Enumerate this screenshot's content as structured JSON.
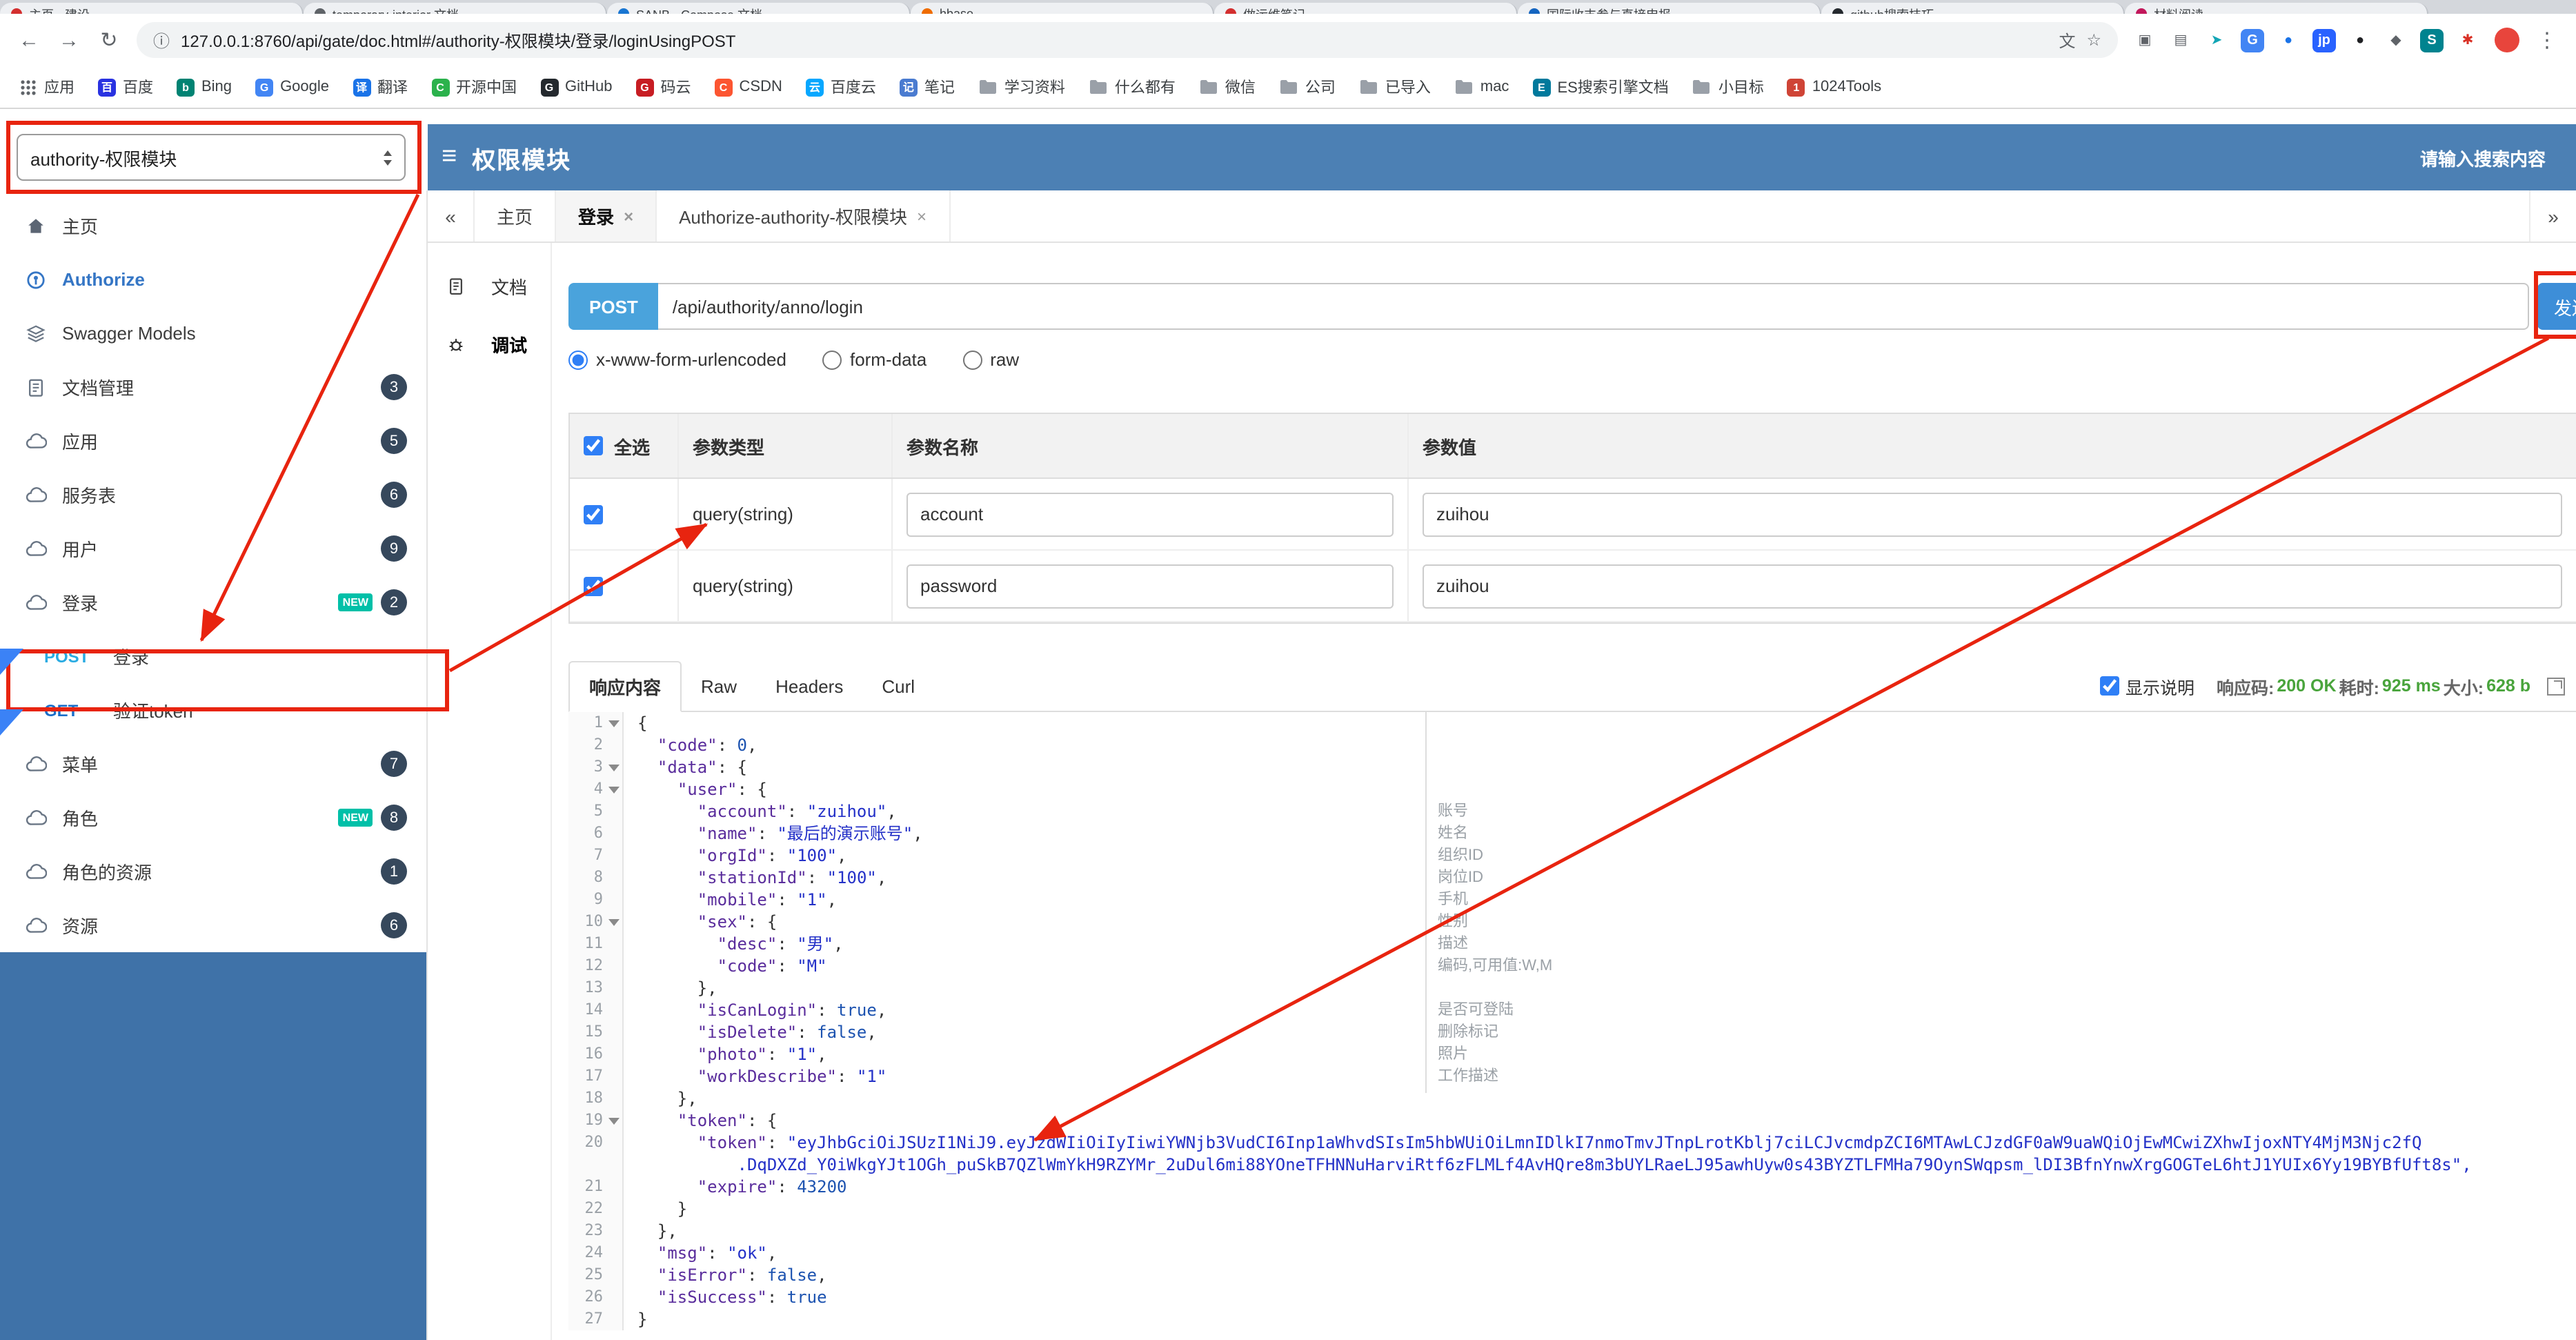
{
  "colors": {
    "header_blue": "#4c80b4",
    "sidebar_fill": "#3f72a8",
    "post_badge": "#4aa3dc",
    "method_post": "#29abe2",
    "method_get": "#1a6fc9",
    "send_button": "#3d8ed8",
    "badge_bg": "#36485c",
    "new_tag": "#00c0a8",
    "success_green": "#49a43c",
    "annotation_red": "#e8240f",
    "marker_blue": "#3b82f6",
    "accent_blue": "#2f7ff6",
    "authorize_blue": "#3576c5"
  },
  "icons": {
    "back": "←",
    "forward": "→",
    "reload": "↻",
    "info": "ⓘ",
    "translate": "文",
    "star": "☆",
    "more": "⋮",
    "hamburger": "≡",
    "prev_tabs": "«",
    "next_tabs": "»",
    "close": "×"
  },
  "browser": {
    "url": "127.0.0.1:8760/api/gate/doc.html#/authority-权限模块/登录/loginUsingPOST",
    "tabs": [
      {
        "title": "主页 - 建设…",
        "color": "#d32f2f"
      },
      {
        "title": "temporary-interior 文档",
        "color": "#5f6368"
      },
      {
        "title": "SANB - Compose 文档",
        "color": "#1976d2"
      },
      {
        "title": "hbase",
        "color": "#ef6c00"
      },
      {
        "title": "做运维笔记",
        "color": "#d32f2f"
      },
      {
        "title": "国际收支参与直接申报",
        "color": "#1565c0"
      },
      {
        "title": "github搜索技巧",
        "color": "#24292e"
      },
      {
        "title": "材料阅读",
        "color": "#c2185b"
      }
    ],
    "extensions": [
      {
        "name": "side-panel-icon",
        "glyph": "▣",
        "fg": "#5f6368",
        "bg": ""
      },
      {
        "name": "reader-ext-icon",
        "glyph": "▤",
        "fg": "#5f6368",
        "bg": ""
      },
      {
        "name": "send-ext-icon",
        "glyph": "➤",
        "fg": "#12a5b5",
        "bg": ""
      },
      {
        "name": "google-ext-icon",
        "glyph": "G",
        "fg": "#ffffff",
        "bg": "#4285f4"
      },
      {
        "name": "docs-ext-icon",
        "glyph": "●",
        "fg": "#1a73e8",
        "bg": ""
      },
      {
        "name": "jp-ext-icon",
        "glyph": "jp",
        "fg": "#ffffff",
        "bg": "#2962ff"
      },
      {
        "name": "circle-ext-icon",
        "glyph": "●",
        "fg": "#202124",
        "bg": ""
      },
      {
        "name": "shield-ext-icon",
        "glyph": "◆",
        "fg": "#5f6368",
        "bg": ""
      },
      {
        "name": "snip-ext-icon",
        "glyph": "S",
        "fg": "#ffffff",
        "bg": "#00838f"
      },
      {
        "name": "pinwheel-ext-icon",
        "glyph": "✱",
        "fg": "#d93025",
        "bg": ""
      }
    ],
    "bookmarks": [
      {
        "label": "应用",
        "icon": "grid"
      },
      {
        "label": "百度",
        "icon": "letter",
        "letter": "百",
        "color": "#2932e1"
      },
      {
        "label": "Bing",
        "icon": "letter",
        "letter": "b",
        "color": "#008373"
      },
      {
        "label": "Google",
        "icon": "letter",
        "letter": "G",
        "color": "#4285f4"
      },
      {
        "label": "翻译",
        "icon": "letter",
        "letter": "译",
        "color": "#1a73e8"
      },
      {
        "label": "开源中国",
        "icon": "letter",
        "letter": "C",
        "color": "#2bb24c"
      },
      {
        "label": "GitHub",
        "icon": "letter",
        "letter": "G",
        "color": "#24292e"
      },
      {
        "label": "码云",
        "icon": "letter",
        "letter": "G",
        "color": "#c71d23"
      },
      {
        "label": "CSDN",
        "icon": "letter",
        "letter": "C",
        "color": "#fc5531"
      },
      {
        "label": "百度云",
        "icon": "letter",
        "letter": "云",
        "color": "#06a7ff"
      },
      {
        "label": "笔记",
        "icon": "letter",
        "letter": "记",
        "color": "#4a7bd0"
      },
      {
        "label": "学习资料",
        "icon": "folder"
      },
      {
        "label": "什么都有",
        "icon": "folder"
      },
      {
        "label": "微信",
        "icon": "folder"
      },
      {
        "label": "公司",
        "icon": "folder"
      },
      {
        "label": "已导入",
        "icon": "folder"
      },
      {
        "label": "mac",
        "icon": "folder"
      },
      {
        "label": "ES搜索引擎文档",
        "icon": "letter",
        "letter": "E",
        "color": "#00799c"
      },
      {
        "label": "小目标",
        "icon": "folder"
      },
      {
        "label": "1024Tools",
        "icon": "letter",
        "letter": "1",
        "color": "#cf4436"
      }
    ]
  },
  "header": {
    "group_select": "authority-权限模块",
    "title": "权限模块",
    "search_placeholder": "请输入搜索内容"
  },
  "sidebar": {
    "new_label": "NEW",
    "items": [
      {
        "label": "主页",
        "icon": "home"
      },
      {
        "label": "Authorize",
        "icon": "auth",
        "accent": true
      },
      {
        "label": "Swagger Models",
        "icon": "models"
      },
      {
        "label": "文档管理",
        "icon": "docs",
        "badge": "3"
      },
      {
        "label": "应用",
        "icon": "api",
        "badge": "5"
      },
      {
        "label": "服务表",
        "icon": "api",
        "badge": "6"
      },
      {
        "label": "用户",
        "icon": "api",
        "badge": "9"
      },
      {
        "label": "登录",
        "icon": "api",
        "badge": "2",
        "isNew": true
      },
      {
        "label": "登录",
        "method": "POST"
      },
      {
        "label": "验证token",
        "method": "GET"
      },
      {
        "label": "菜单",
        "icon": "api",
        "badge": "7"
      },
      {
        "label": "角色",
        "icon": "api",
        "badge": "8",
        "isNew": true
      },
      {
        "label": "角色的资源",
        "icon": "api",
        "badge": "1"
      },
      {
        "label": "资源",
        "icon": "api",
        "badge": "6"
      }
    ]
  },
  "tabs": {
    "items": [
      {
        "label": "主页",
        "closable": false,
        "active": false
      },
      {
        "label": "登录",
        "closable": true,
        "active": true
      },
      {
        "label": "Authorize-authority-权限模块",
        "closable": true,
        "active": false
      }
    ]
  },
  "doc_nav": [
    {
      "label": "文档",
      "icon": "doc",
      "active": false
    },
    {
      "label": "调试",
      "icon": "debug",
      "active": true
    }
  ],
  "debug": {
    "method": "POST",
    "url": "/api/authority/anno/login",
    "send_label": "发送",
    "content_types": [
      {
        "label": "x-www-form-urlencoded",
        "selected": true
      },
      {
        "label": "form-data",
        "selected": false
      },
      {
        "label": "raw",
        "selected": false
      }
    ],
    "params": {
      "select_all_checked": true,
      "headers": {
        "select_all": "全选",
        "type": "参数类型",
        "name": "参数名称",
        "value": "参数值"
      },
      "rows": [
        {
          "checked": true,
          "type": "query(string)",
          "name": "account",
          "value": "zuihou"
        },
        {
          "checked": true,
          "type": "query(string)",
          "name": "password",
          "value": "zuihou"
        }
      ]
    }
  },
  "response": {
    "tabs": [
      {
        "label": "响应内容",
        "active": true
      },
      {
        "label": "Raw",
        "active": false
      },
      {
        "label": "Headers",
        "active": false
      },
      {
        "label": "Curl",
        "active": false
      }
    ],
    "show_desc_label": "显示说明",
    "show_desc_checked": true,
    "meta": {
      "code_label": "响应码:",
      "code": "200 OK",
      "time_label": "耗时:",
      "time": "925 ms",
      "size_label": "大小:",
      "size": "628 b"
    },
    "code_rows": [
      {
        "n": "1",
        "t": "{",
        "fold": true
      },
      {
        "n": "2",
        "t": "  \"code\": 0,"
      },
      {
        "n": "3",
        "t": "  \"data\": {",
        "fold": true
      },
      {
        "n": "4",
        "t": "    \"user\": {",
        "fold": true
      },
      {
        "n": "5",
        "t": "      \"account\": \"zuihou\","
      },
      {
        "n": "6",
        "t": "      \"name\": \"最后的演示账号\","
      },
      {
        "n": "7",
        "t": "      \"orgId\": \"100\","
      },
      {
        "n": "8",
        "t": "      \"stationId\": \"100\","
      },
      {
        "n": "9",
        "t": "      \"mobile\": \"1\","
      },
      {
        "n": "10",
        "t": "      \"sex\": {",
        "fold": true
      },
      {
        "n": "11",
        "t": "        \"desc\": \"男\","
      },
      {
        "n": "12",
        "t": "        \"code\": \"M\""
      },
      {
        "n": "13",
        "t": "      },"
      },
      {
        "n": "14",
        "t": "      \"isCanLogin\": true,"
      },
      {
        "n": "15",
        "t": "      \"isDelete\": false,"
      },
      {
        "n": "16",
        "t": "      \"photo\": \"1\","
      },
      {
        "n": "17",
        "t": "      \"workDescribe\": \"1\""
      },
      {
        "n": "18",
        "t": "    },"
      },
      {
        "n": "19",
        "t": "    \"token\": {",
        "fold": true
      },
      {
        "n": "20",
        "t": "      \"token\": \"eyJhbGciOiJSUzI1NiJ9.eyJzdWIiOiIyIiwiYWNjb3VudCI6Inp1aWhvdSIsIm5hbWUiOiLmnIDlkI7nmoTmvJTnpLrotKblj7ciLCJvcmdpZCI6MTAwLCJzdGF0aW9uaWQiOjEwMCwiZXhwIjoxNTY4MjM3Njc2fQ"
      },
      {
        "n": "",
        "t": "          .DqDXZd_Y0iWkgYJt1OGh_puSkB7QZlWmYkH9RZYMr_2uDul6mi88YOneTFHNNuHarviRtf6zFLMLf4AvHQre8m3bUYLRaeLJ95awhUyw0s43BYZTLFMHa79OynSWqpsm_lDI3BfnYnwXrgGOGTeL6htJ1YUIx6Yy19BYBfUft8s\","
      },
      {
        "n": "21",
        "t": "      \"expire\": 43200"
      },
      {
        "n": "22",
        "t": "    }"
      },
      {
        "n": "23",
        "t": "  },"
      },
      {
        "n": "24",
        "t": "  \"msg\": \"ok\","
      },
      {
        "n": "25",
        "t": "  \"isError\": false,"
      },
      {
        "n": "26",
        "t": "  \"isSuccess\": true"
      },
      {
        "n": "27",
        "t": "}"
      }
    ],
    "annotations": [
      {
        "row": 5,
        "text": "账号"
      },
      {
        "row": 6,
        "text": "姓名"
      },
      {
        "row": 7,
        "text": "组织ID"
      },
      {
        "row": 8,
        "text": "岗位ID"
      },
      {
        "row": 9,
        "text": "手机"
      },
      {
        "row": 10,
        "text": "性别"
      },
      {
        "row": 11,
        "text": "描述"
      },
      {
        "row": 12,
        "text": "编码,可用值:W,M"
      },
      {
        "row": 14,
        "text": "是否可登陆"
      },
      {
        "row": 15,
        "text": "删除标记"
      },
      {
        "row": 16,
        "text": "照片"
      },
      {
        "row": 17,
        "text": "工作描述"
      }
    ]
  }
}
